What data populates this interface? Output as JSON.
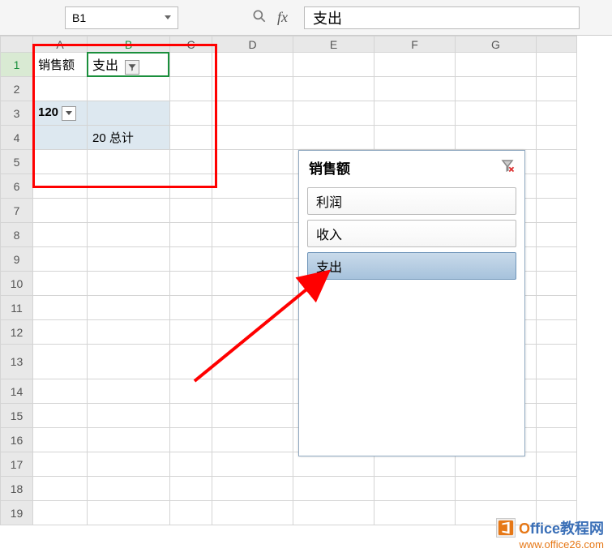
{
  "formula_bar": {
    "name_box": "B1",
    "fx_label": "fx",
    "formula_value": "支出"
  },
  "columns": [
    "A",
    "B",
    "C",
    "D",
    "E",
    "F",
    "G"
  ],
  "active_column": "B",
  "rows": [
    "1",
    "2",
    "3",
    "4",
    "5",
    "6",
    "7",
    "8",
    "9",
    "10",
    "11",
    "12",
    "13",
    "14",
    "15",
    "16",
    "17",
    "18",
    "19"
  ],
  "active_row": "1",
  "cells": {
    "A1": "销售额",
    "B1": "支出",
    "A3": "120",
    "B4": "20 总计"
  },
  "slicer": {
    "title": "销售额",
    "items": [
      {
        "label": "利润",
        "selected": false
      },
      {
        "label": "收入",
        "selected": false
      },
      {
        "label": "支出",
        "selected": true
      }
    ]
  },
  "watermark": {
    "brand_prefix": "O",
    "brand_rest": "ffice教程网",
    "url": "www.office26.com"
  }
}
